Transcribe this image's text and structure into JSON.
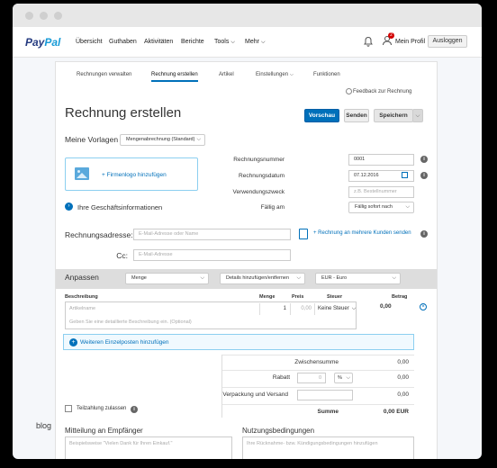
{
  "topnav": {
    "logo": {
      "pay": "Pay",
      "pal": "Pal"
    },
    "items": [
      "Übersicht",
      "Guthaben",
      "Aktivitäten",
      "Berichte",
      "Tools",
      "Mehr"
    ],
    "profile_label": "Mein Profil",
    "notification_count": "2",
    "logout_label": "Ausloggen"
  },
  "subtabs": [
    "Rechnungen verwalten",
    "Rechnung erstellen",
    "Artikel",
    "Einstellungen",
    "Funktionen"
  ],
  "feedback_label": "Feedback zur Rechnung",
  "page_title": "Rechnung erstellen",
  "buttons": {
    "preview": "Vorschau",
    "send": "Senden",
    "save": "Speichern"
  },
  "templates": {
    "label": "Meine Vorlagen",
    "selected": "Mengenabrechnung (Standard)"
  },
  "logo_box": {
    "label": "Firmenlogo hinzufügen"
  },
  "invoice_fields": {
    "number_label": "Rechnungsnummer",
    "number_value": "0001",
    "date_label": "Rechnungsdatum",
    "date_value": "07.12.2016",
    "reference_label": "Verwendungszweck",
    "reference_placeholder": "z.B. Bestellnummer",
    "due_label": "Fällig am",
    "due_value": "Fällig sofort nach"
  },
  "business_info": "Ihre Geschäftsinformationen",
  "recipient": {
    "label": "Rechnungsadresse:",
    "placeholder": "E-Mail-Adresse oder Name",
    "cc_label": "Cc:",
    "cc_placeholder": "E-Mail-Adresse",
    "multi_link": "+ Rechnung an mehrere Kunden senden"
  },
  "customize": {
    "label": "Anpassen",
    "quantity_select": "Menge",
    "details_select": "Details hinzufügen/entfernen",
    "currency_select": "EUR - Euro"
  },
  "table": {
    "headers": {
      "description": "Beschreibung",
      "quantity": "Menge",
      "price": "Preis",
      "tax": "Steuer",
      "amount": "Betrag"
    },
    "item": {
      "name_placeholder": "Artikelname",
      "desc_placeholder": "Geben Sie eine detaillierte Beschreibung ein. (Optional)",
      "quantity": "1",
      "price": "0,00",
      "tax": "Keine Steuer",
      "amount": "0,00"
    }
  },
  "add_items_label": "Weiteren Einzelposten hinzufügen",
  "totals": {
    "subtotal_label": "Zwischensumme",
    "subtotal_value": "0,00",
    "discount_label": "Rabatt",
    "discount_input": "0",
    "discount_unit": "%",
    "discount_value": "0,00",
    "shipping_label": "Verpackung und Versand",
    "shipping_value": "0,00",
    "total_label": "Summe",
    "total_value": "0,00 EUR"
  },
  "partial_payment_label": "Teilzahlung zulassen",
  "message": {
    "label": "Mitteilung an Empfänger",
    "placeholder": "Beispielsweise \"Vielen Dank für Ihren Einkauf.\""
  },
  "terms": {
    "label": "Nutzungsbedingungen",
    "placeholder": "Ihre Rücknahme- bzw. Kündigungsbedingungen hinzufügen"
  },
  "watermark": "blog"
}
